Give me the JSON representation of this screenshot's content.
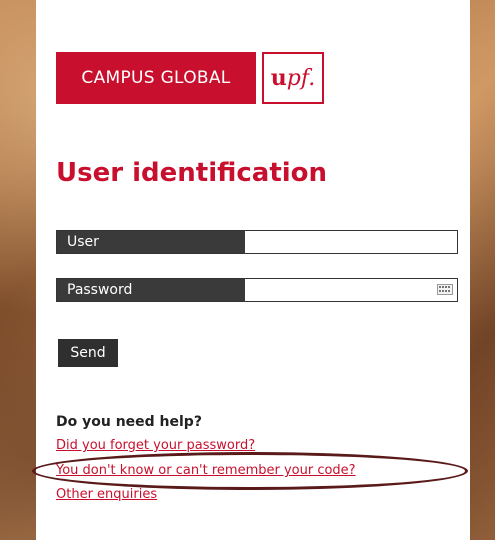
{
  "logo": {
    "text": "CAMPUS GLOBAL",
    "mark_bold": "u",
    "mark_italic": "pf."
  },
  "heading": "User identification",
  "form": {
    "user_label": "User",
    "user_value": "",
    "password_label": "Password",
    "password_value": "",
    "send_label": "Send"
  },
  "help": {
    "title": "Do you need help?",
    "links": [
      "Did you forget your password?",
      "You don't know or can't remember your code?",
      "Other enquiries"
    ]
  },
  "colors": {
    "brand": "#c8102e",
    "label_bg": "#3a3a3a",
    "highlight": "#5a1a1a"
  },
  "icons": {
    "password_field": "keyboard-icon"
  }
}
